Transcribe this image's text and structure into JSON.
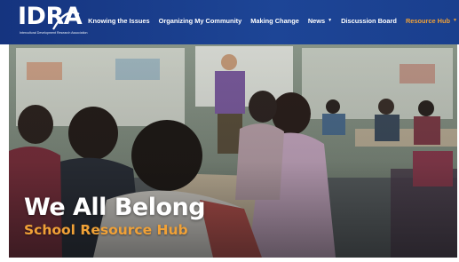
{
  "header": {
    "logo_text": "IDRA",
    "logo_subtitle": "Intercultural Development Research Association",
    "nav": [
      {
        "label": "Knowing the Issues",
        "dropdown": false
      },
      {
        "label": "Organizing My Community",
        "dropdown": false
      },
      {
        "label": "Making Change",
        "dropdown": false
      },
      {
        "label": "News",
        "dropdown": true
      },
      {
        "label": "Discussion Board",
        "dropdown": false
      },
      {
        "label": "Resource Hub",
        "dropdown": true
      }
    ]
  },
  "hero": {
    "headline": "We All Belong",
    "subheadline": "School Resource Hub"
  },
  "colors": {
    "nav_background": "#1d4596",
    "accent": "#f0a137",
    "nav_text": "#ffffff"
  },
  "icons": {
    "dropdown": "chevron-down-icon"
  }
}
